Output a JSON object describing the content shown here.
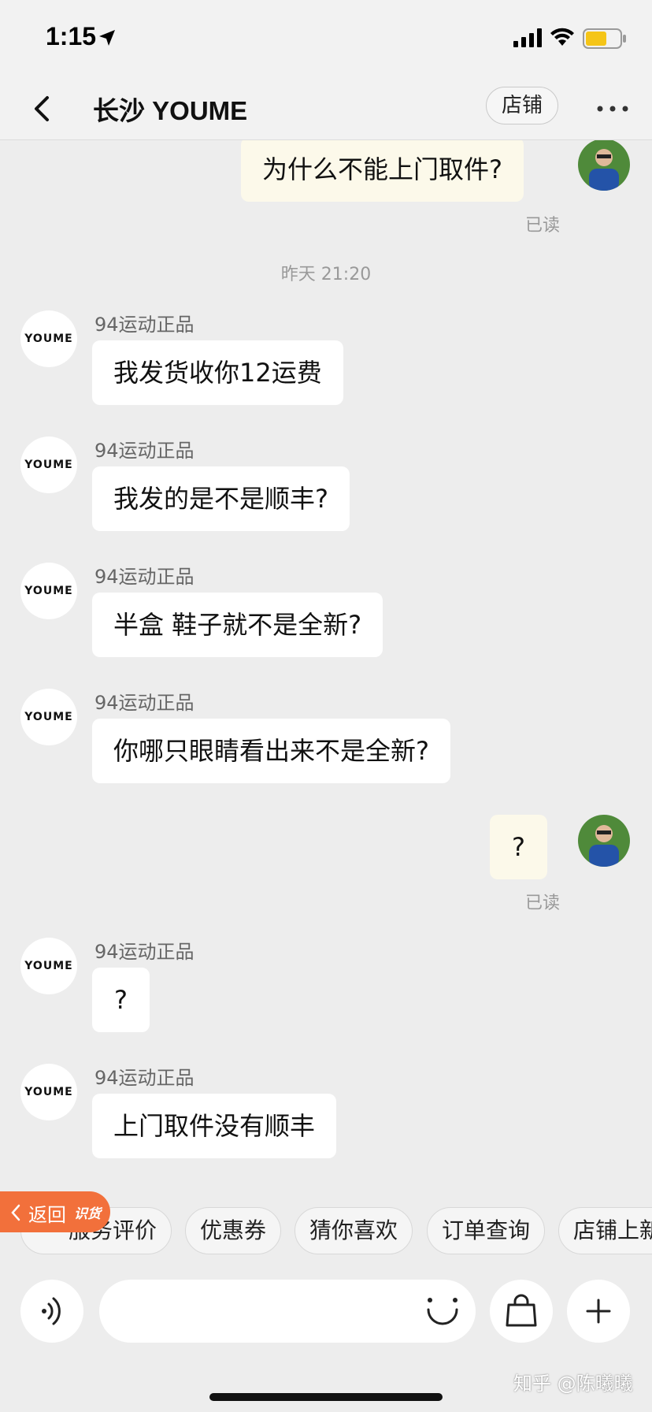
{
  "status_bar": {
    "time": "1:15",
    "icons": [
      "location-arrow-icon",
      "signal-icon",
      "wifi-icon",
      "battery-icon"
    ],
    "battery_color": "#f5c518"
  },
  "header": {
    "title": "长沙 YOUME",
    "shop_label": "店铺",
    "icons": [
      "back-arrow-icon",
      "more-icon"
    ]
  },
  "chat": {
    "shop_avatar_text": "YOUME",
    "messages": [
      {
        "from": "me",
        "text": "为什么不能上门取件?",
        "status": "已读"
      },
      {
        "type": "timestamp",
        "text": "昨天 21:20"
      },
      {
        "from": "shop",
        "sender": "94运动正品",
        "text": "我发货收你12运费"
      },
      {
        "from": "shop",
        "sender": "94运动正品",
        "text": "我发的是不是顺丰?"
      },
      {
        "from": "shop",
        "sender": "94运动正品",
        "text": "半盒 鞋子就不是全新?"
      },
      {
        "from": "shop",
        "sender": "94运动正品",
        "text": "你哪只眼睛看出来不是全新?"
      },
      {
        "from": "me",
        "text": "?",
        "status": "已读"
      },
      {
        "from": "shop",
        "sender": "94运动正品",
        "text": "?"
      },
      {
        "from": "shop",
        "sender": "94运动正品",
        "text": "上门取件没有顺丰"
      }
    ]
  },
  "quick_actions": [
    "服务评价",
    "优惠券",
    "猜你喜欢",
    "订单查询",
    "店铺上新"
  ],
  "return_button": {
    "label": "返回",
    "badge": "识货"
  },
  "input_bar": {
    "placeholder": "",
    "icons": [
      "voice-icon",
      "emoji-icon",
      "shopping-bag-icon",
      "plus-icon"
    ]
  },
  "watermark": "知乎 @陈曦曦",
  "colors": {
    "accent": "#f2703b",
    "incoming_bubble": "#ffffff",
    "outgoing_bubble": "#fcf9ea",
    "background": "#ededed"
  }
}
